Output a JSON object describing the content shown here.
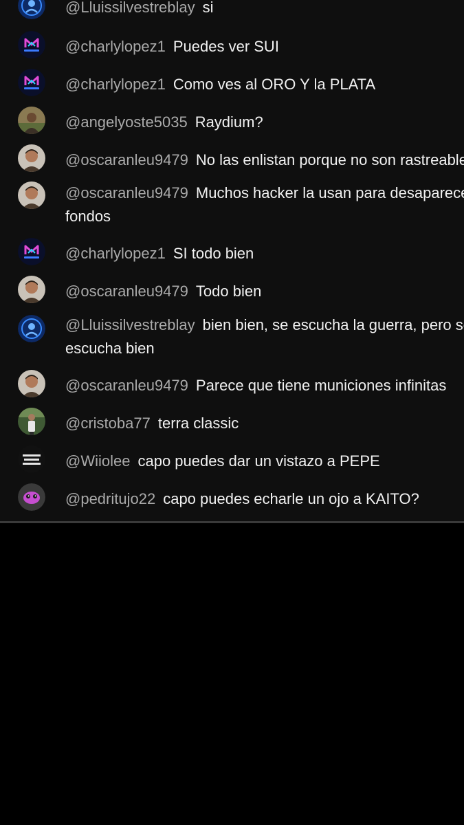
{
  "chat": {
    "messages": [
      {
        "author": "@Lluissilvestreblay",
        "text": "si",
        "avatar": "blue-orb-avatar"
      },
      {
        "author": "@charlylopez1",
        "text": "Puedes ver SUI",
        "avatar": "meta-logo-avatar"
      },
      {
        "author": "@charlylopez1",
        "text": "Como ves al ORO Y la PLATA",
        "avatar": "meta-logo-avatar"
      },
      {
        "author": "@angelyoste5035",
        "text": "Raydium?",
        "avatar": "photo-avatar"
      },
      {
        "author": "@oscaranleu9479",
        "text": "No las enlistan porque no son rastreables",
        "avatar": "photo-avatar"
      },
      {
        "author": "@oscaranleu9479",
        "text": "Muchos hacker la usan para desaparecer fondos",
        "avatar": "photo-avatar"
      },
      {
        "author": "@charlylopez1",
        "text": "SI todo bien",
        "avatar": "meta-logo-avatar"
      },
      {
        "author": "@oscaranleu9479",
        "text": "Todo bien",
        "avatar": "photo-avatar"
      },
      {
        "author": "@Lluissilvestreblay",
        "text": "bien bien, se escucha la guerra, pero se escucha bien",
        "avatar": "blue-orb-avatar"
      },
      {
        "author": "@oscaranleu9479",
        "text": "Parece que tiene municiones infinitas",
        "avatar": "photo-avatar"
      },
      {
        "author": "@cristoba77",
        "text": "terra classic",
        "avatar": "photo-avatar"
      },
      {
        "author": "@Wiiolee",
        "text": "capo puedes dar un vistazo a PEPE",
        "avatar": "text-logo-avatar"
      },
      {
        "author": "@pedritujo22",
        "text": "capo puedes echarle un ojo a KAITO?",
        "avatar": "pink-creature-avatar"
      }
    ]
  },
  "colors": {
    "panel_bg": "#0f0f0f",
    "author": "#aaaaaa",
    "message": "#f1f1f1",
    "page_bg": "#000000"
  }
}
